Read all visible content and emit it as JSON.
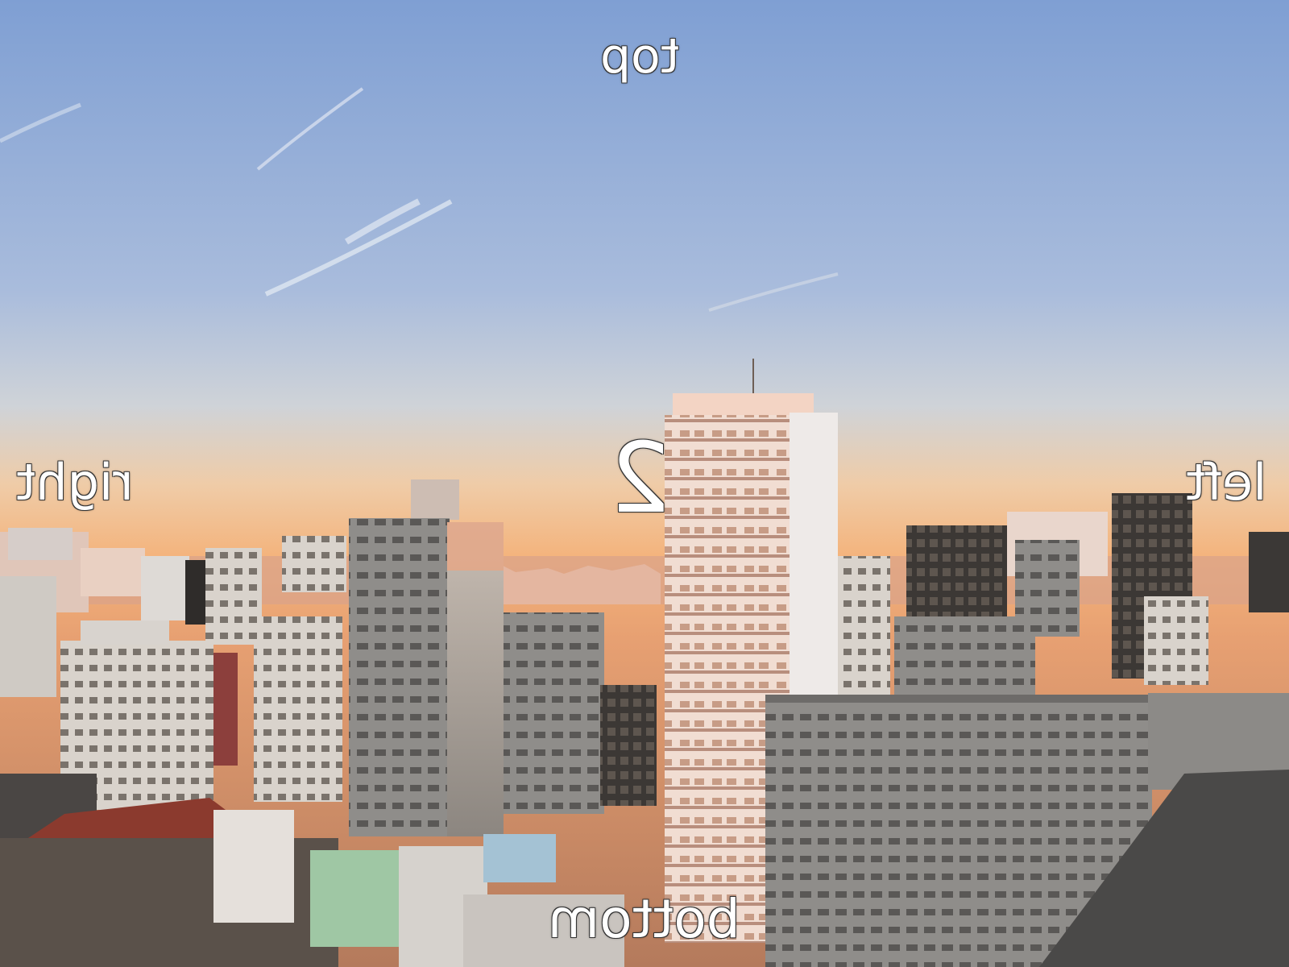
{
  "labels": {
    "top": "top",
    "right": "right",
    "left": "left",
    "bottom": "bottom",
    "number": "2"
  },
  "colors": {
    "sky_top": "#7f9fd3",
    "sky_mid": "#b8c7dc",
    "sky_horizon": "#f2b57c",
    "sunlit_tower": "#f0d7c8",
    "shaded_building": "#8e8c8a",
    "dark_building": "#3a3633",
    "label_text": "#ffffff"
  }
}
